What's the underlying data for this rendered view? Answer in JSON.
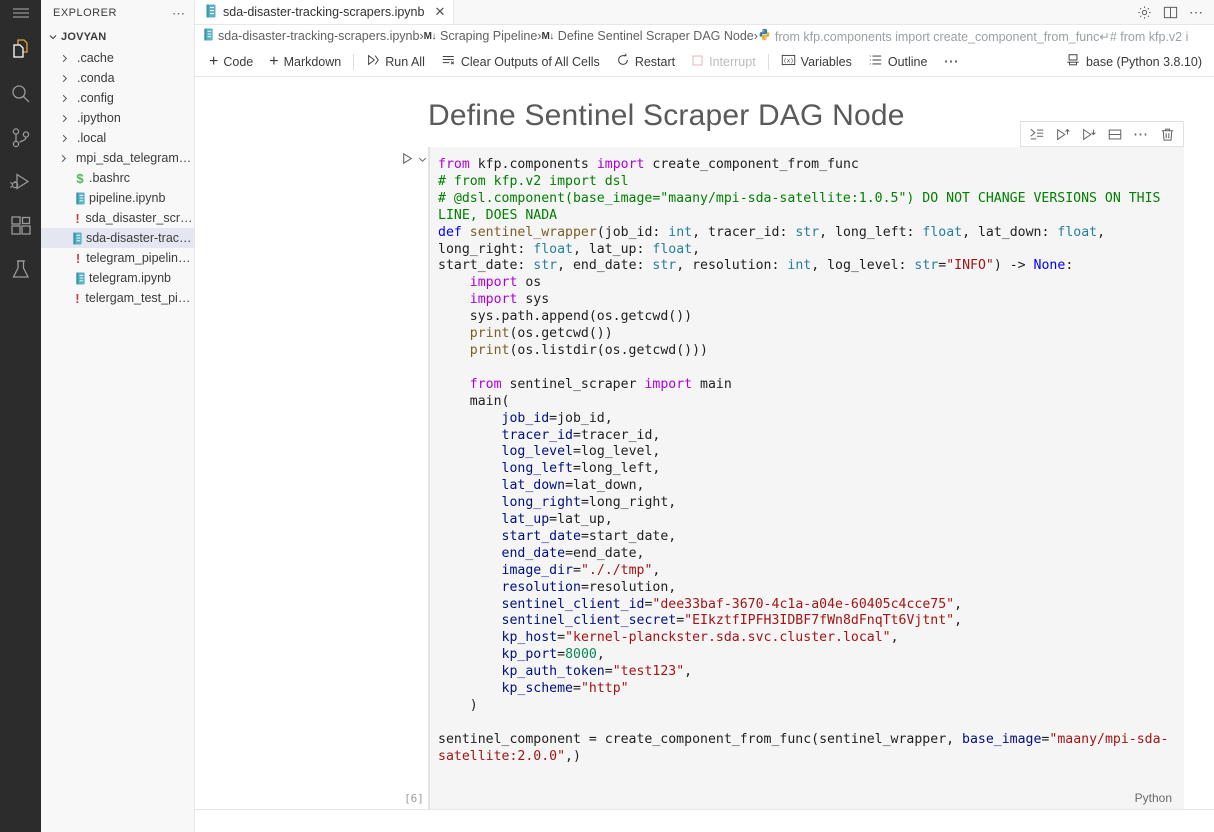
{
  "activitybar": {
    "items": [
      {
        "name": "menu-icon",
        "title": "Menu"
      },
      {
        "name": "explorer-icon",
        "title": "Explorer"
      },
      {
        "name": "search-icon",
        "title": "Search"
      },
      {
        "name": "source-control-icon",
        "title": "Source Control"
      },
      {
        "name": "run-and-debug-icon",
        "title": "Run and Debug"
      },
      {
        "name": "extensions-icon",
        "title": "Extensions"
      },
      {
        "name": "testing-icon",
        "title": "Testing"
      }
    ]
  },
  "sidebar": {
    "title": "EXPLORER",
    "more_label": "⋯",
    "root": "JOVYAN",
    "items": [
      {
        "label": ".cache",
        "kind": "folder"
      },
      {
        "label": ".conda",
        "kind": "folder"
      },
      {
        "label": ".config",
        "kind": "folder"
      },
      {
        "label": ".ipython",
        "kind": "folder"
      },
      {
        "label": ".local",
        "kind": "folder"
      },
      {
        "label": "mpi_sda_telegram_s...",
        "kind": "folder"
      },
      {
        "label": ".bashrc",
        "kind": "shell"
      },
      {
        "label": "pipeline.ipynb",
        "kind": "notebook"
      },
      {
        "label": "sda_disaster_scrapi...",
        "kind": "yaml"
      },
      {
        "label": "sda-disaster-trackin...",
        "kind": "notebook",
        "selected": true
      },
      {
        "label": "telegram_pipeline.y...",
        "kind": "yaml"
      },
      {
        "label": "telegram.ipynb",
        "kind": "notebook"
      },
      {
        "label": "telergam_test_pipeli...",
        "kind": "yaml"
      }
    ]
  },
  "tabbar": {
    "tab_label": "sda-disaster-tracking-scrapers.ipynb",
    "close_label": "✕",
    "actions": [
      {
        "name": "settings-gear-icon"
      },
      {
        "name": "split-editor-icon"
      },
      {
        "name": "more-actions-icon"
      }
    ]
  },
  "breadcrumbs": {
    "file": "sda-disaster-tracking-scrapers.ipynb",
    "markdown_badge": "M↓",
    "section": "Scraping Pipeline",
    "subsection": "Define Sentinel Scraper DAG Node",
    "cell": "from kfp.components import create_component_from_func↵# from kfp.v2 i",
    "separator": "›"
  },
  "toolbar": {
    "add_code": "Code",
    "add_markdown": "Markdown",
    "run_all": "Run All",
    "clear_outputs": "Clear Outputs of All Cells",
    "restart": "Restart",
    "interrupt": "Interrupt",
    "variables": "Variables",
    "outline": "Outline",
    "more": "⋯",
    "kernel": "base (Python 3.8.10)"
  },
  "notebook": {
    "title": "Define Sentinel Scraper DAG Node",
    "execution_count": "[6]",
    "language": "Python",
    "cell_toolbar": [
      {
        "name": "execute-above-cells-icon"
      },
      {
        "name": "run-by-line-icon"
      },
      {
        "name": "execute-cell-and-below-icon"
      },
      {
        "name": "split-cell-icon"
      },
      {
        "name": "more-cell-actions-icon"
      },
      {
        "name": "delete-cell-icon"
      }
    ],
    "code_lines": [
      [
        [
          "kw",
          "from"
        ],
        [
          "plain",
          " kfp.components "
        ],
        [
          "kw",
          "import"
        ],
        [
          "plain",
          " create_component_from_func"
        ]
      ],
      [
        [
          "cmt",
          "# from kfp.v2 import dsl"
        ]
      ],
      [
        [
          "cmt",
          "# @dsl.component(base_image=\"maany/mpi-sda-satellite:1.0.5\") DO NOT CHANGE VERSIONS ON THIS LINE, DOES NADA"
        ]
      ],
      [
        [
          "kw2",
          "def"
        ],
        [
          "plain",
          " "
        ],
        [
          "def",
          "sentinel_wrapper"
        ],
        [
          "plain",
          "(job_id: "
        ],
        [
          "typ",
          "int"
        ],
        [
          "plain",
          ", tracer_id: "
        ],
        [
          "typ",
          "str"
        ],
        [
          "plain",
          ", long_left: "
        ],
        [
          "typ",
          "float"
        ],
        [
          "plain",
          ", lat_down: "
        ],
        [
          "typ",
          "float"
        ],
        [
          "plain",
          ", long_right: "
        ],
        [
          "typ",
          "float"
        ],
        [
          "plain",
          ", lat_up: "
        ],
        [
          "typ",
          "float"
        ],
        [
          "plain",
          ","
        ]
      ],
      [
        [
          "plain",
          "start_date: "
        ],
        [
          "typ",
          "str"
        ],
        [
          "plain",
          ", end_date: "
        ],
        [
          "typ",
          "str"
        ],
        [
          "plain",
          ", resolution: "
        ],
        [
          "typ",
          "int"
        ],
        [
          "plain",
          ", log_level: "
        ],
        [
          "typ",
          "str"
        ],
        [
          "plain",
          "="
        ],
        [
          "str",
          "\"INFO\""
        ],
        [
          "plain",
          ") -> "
        ],
        [
          "kw2",
          "None"
        ],
        [
          "plain",
          ":"
        ]
      ],
      [
        [
          "plain",
          "    "
        ],
        [
          "kw",
          "import"
        ],
        [
          "plain",
          " os"
        ]
      ],
      [
        [
          "plain",
          "    "
        ],
        [
          "kw",
          "import"
        ],
        [
          "plain",
          " sys"
        ]
      ],
      [
        [
          "plain",
          "    sys.path.append(os.getcwd())"
        ]
      ],
      [
        [
          "plain",
          "    "
        ],
        [
          "fn",
          "print"
        ],
        [
          "plain",
          "(os.getcwd())"
        ]
      ],
      [
        [
          "plain",
          "    "
        ],
        [
          "fn",
          "print"
        ],
        [
          "plain",
          "(os.listdir(os.getcwd()))"
        ]
      ],
      [
        [
          "plain",
          ""
        ]
      ],
      [
        [
          "plain",
          "    "
        ],
        [
          "kw",
          "from"
        ],
        [
          "plain",
          " sentinel_scraper "
        ],
        [
          "kw",
          "import"
        ],
        [
          "plain",
          " main"
        ]
      ],
      [
        [
          "plain",
          "    main("
        ]
      ],
      [
        [
          "plain",
          "        "
        ],
        [
          "var",
          "job_id"
        ],
        [
          "plain",
          "=job_id,"
        ]
      ],
      [
        [
          "plain",
          "        "
        ],
        [
          "var",
          "tracer_id"
        ],
        [
          "plain",
          "=tracer_id,"
        ]
      ],
      [
        [
          "plain",
          "        "
        ],
        [
          "var",
          "log_level"
        ],
        [
          "plain",
          "=log_level,"
        ]
      ],
      [
        [
          "plain",
          "        "
        ],
        [
          "var",
          "long_left"
        ],
        [
          "plain",
          "=long_left,"
        ]
      ],
      [
        [
          "plain",
          "        "
        ],
        [
          "var",
          "lat_down"
        ],
        [
          "plain",
          "=lat_down,"
        ]
      ],
      [
        [
          "plain",
          "        "
        ],
        [
          "var",
          "long_right"
        ],
        [
          "plain",
          "=long_right,"
        ]
      ],
      [
        [
          "plain",
          "        "
        ],
        [
          "var",
          "lat_up"
        ],
        [
          "plain",
          "=lat_up,"
        ]
      ],
      [
        [
          "plain",
          "        "
        ],
        [
          "var",
          "start_date"
        ],
        [
          "plain",
          "=start_date,"
        ]
      ],
      [
        [
          "plain",
          "        "
        ],
        [
          "var",
          "end_date"
        ],
        [
          "plain",
          "=end_date,"
        ]
      ],
      [
        [
          "plain",
          "        "
        ],
        [
          "var",
          "image_dir"
        ],
        [
          "plain",
          "="
        ],
        [
          "str",
          "\"././tmp\""
        ],
        [
          "plain",
          ","
        ]
      ],
      [
        [
          "plain",
          "        "
        ],
        [
          "var",
          "resolution"
        ],
        [
          "plain",
          "=resolution,"
        ]
      ],
      [
        [
          "plain",
          "        "
        ],
        [
          "var",
          "sentinel_client_id"
        ],
        [
          "plain",
          "="
        ],
        [
          "str",
          "\"dee33baf-3670-4c1a-a04e-60405c4cce75\""
        ],
        [
          "plain",
          ","
        ]
      ],
      [
        [
          "plain",
          "        "
        ],
        [
          "var",
          "sentinel_client_secret"
        ],
        [
          "plain",
          "="
        ],
        [
          "str",
          "\"EIkztfIPFH3IDBF7fWn8dFnqTt6Vjtnt\""
        ],
        [
          "plain",
          ","
        ]
      ],
      [
        [
          "plain",
          "        "
        ],
        [
          "var",
          "kp_host"
        ],
        [
          "plain",
          "="
        ],
        [
          "str",
          "\"kernel-planckster.sda.svc.cluster.local\""
        ],
        [
          "plain",
          ","
        ]
      ],
      [
        [
          "plain",
          "        "
        ],
        [
          "var",
          "kp_port"
        ],
        [
          "plain",
          "="
        ],
        [
          "num",
          "8000"
        ],
        [
          "plain",
          ","
        ]
      ],
      [
        [
          "plain",
          "        "
        ],
        [
          "var",
          "kp_auth_token"
        ],
        [
          "plain",
          "="
        ],
        [
          "str",
          "\"test123\""
        ],
        [
          "plain",
          ","
        ]
      ],
      [
        [
          "plain",
          "        "
        ],
        [
          "var",
          "kp_scheme"
        ],
        [
          "plain",
          "="
        ],
        [
          "str",
          "\"http\""
        ]
      ],
      [
        [
          "plain",
          "    )"
        ]
      ],
      [
        [
          "plain",
          ""
        ]
      ],
      [
        [
          "plain",
          "sentinel_component = create_component_from_func(sentinel_wrapper, "
        ],
        [
          "var",
          "base_image"
        ],
        [
          "plain",
          "="
        ],
        [
          "str",
          "\"maany/mpi-sda-satellite:2.0.0\""
        ],
        [
          "plain",
          ",)"
        ]
      ]
    ]
  },
  "colors": {
    "accent": "#4a90c4",
    "activitybar_bg": "#2c2c2c",
    "sidebar_bg": "#f8f8f8",
    "cell_bg": "#f5f5f5",
    "selected_row": "#e4e6f1"
  }
}
